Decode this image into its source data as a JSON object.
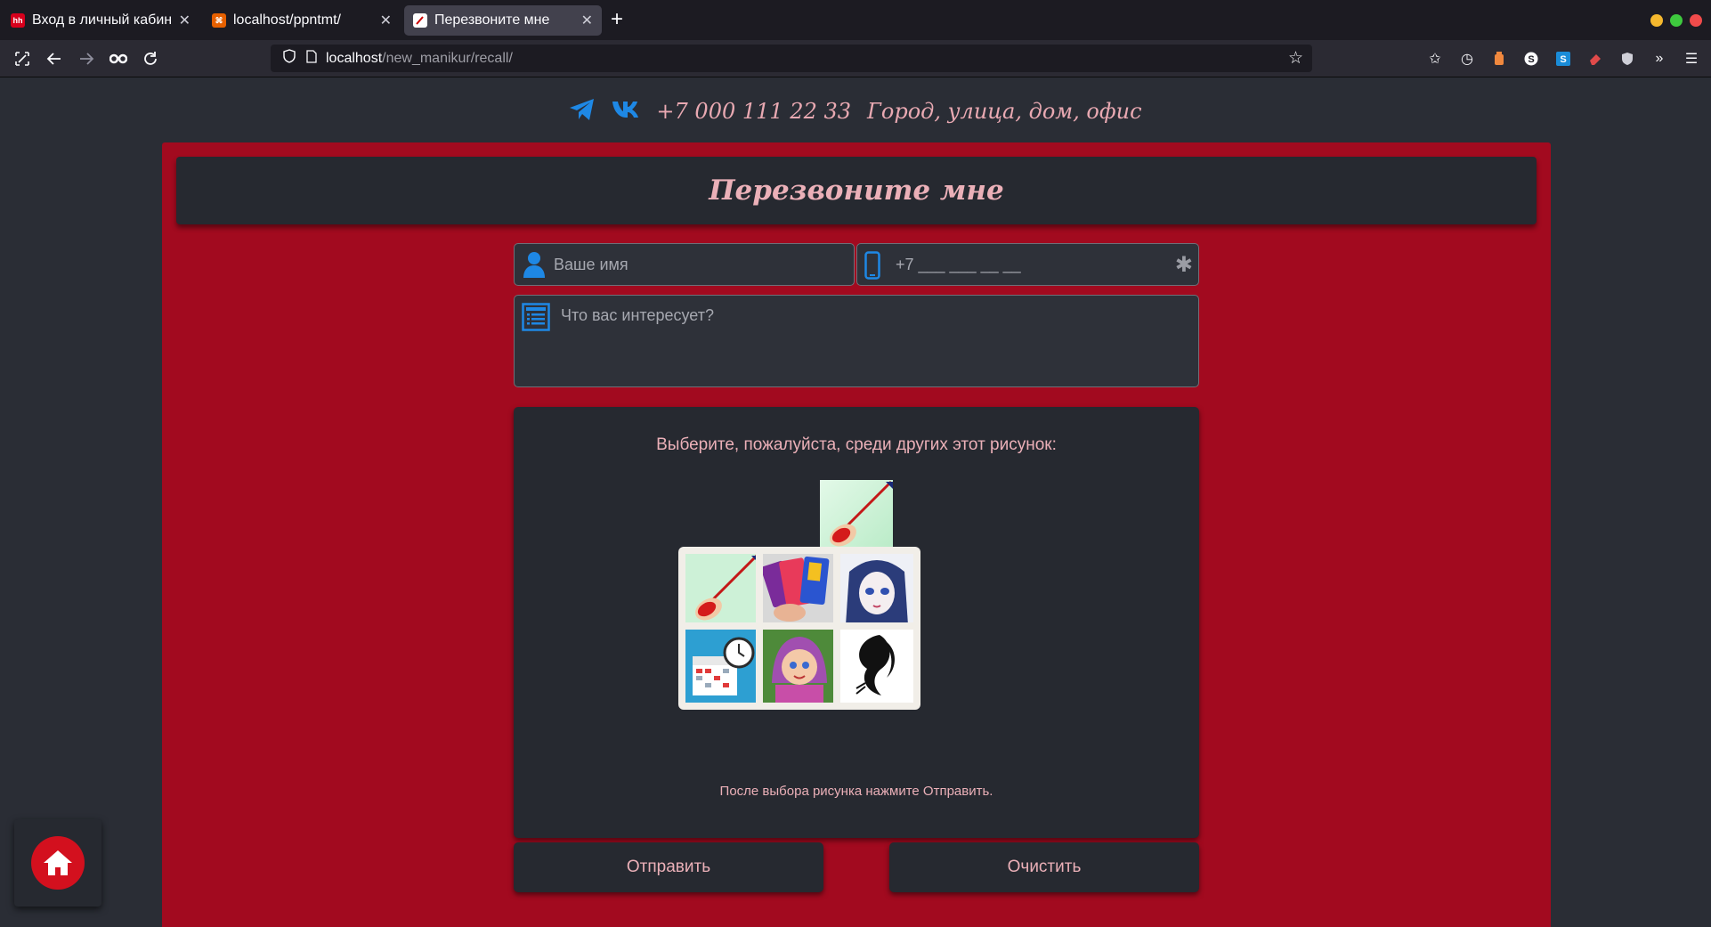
{
  "browser": {
    "tabs": [
      {
        "title": "Вход в личный кабинет",
        "favicon_text": "hh",
        "favicon_color": "#d6001c",
        "active": false
      },
      {
        "title": "localhost/ppntmt/",
        "favicon_text": "",
        "favicon_color": "#e66000",
        "active": false
      },
      {
        "title": "Перезвоните мне",
        "favicon_text": "",
        "favicon_color": "#ffffff",
        "active": true
      }
    ],
    "url_host": "localhost",
    "url_path": "/new_manikur/recall/"
  },
  "contacts": {
    "phone": "+7 000 111 22 33",
    "address": "Город, улица, дом, офис",
    "icons": [
      "telegram-icon",
      "vk-icon"
    ],
    "accent_color": "#1e88e5"
  },
  "form": {
    "title": "Перезвоните мне",
    "name_placeholder": "Ваше имя",
    "phone_placeholder": "+7 ___ ___ __ __",
    "message_placeholder": "Что вас интересует?",
    "required_mark": "✱"
  },
  "captcha": {
    "prompt": "Выберите, пожалуйста, среди других этот рисунок:",
    "sample_image": "nail-polish",
    "choices": [
      "nail-polish",
      "smartphones",
      "anime-girl",
      "calendar-clock",
      "masha-cartoon",
      "hair-silhouette"
    ],
    "note": "После выбора рисунка нажмите Отправить."
  },
  "buttons": {
    "submit_label": "Отправить",
    "clear_label": "Очистить"
  },
  "colors": {
    "panel_red": "#a20a1f",
    "text_pink": "#ebb0b8",
    "home_red": "#d3101e"
  }
}
